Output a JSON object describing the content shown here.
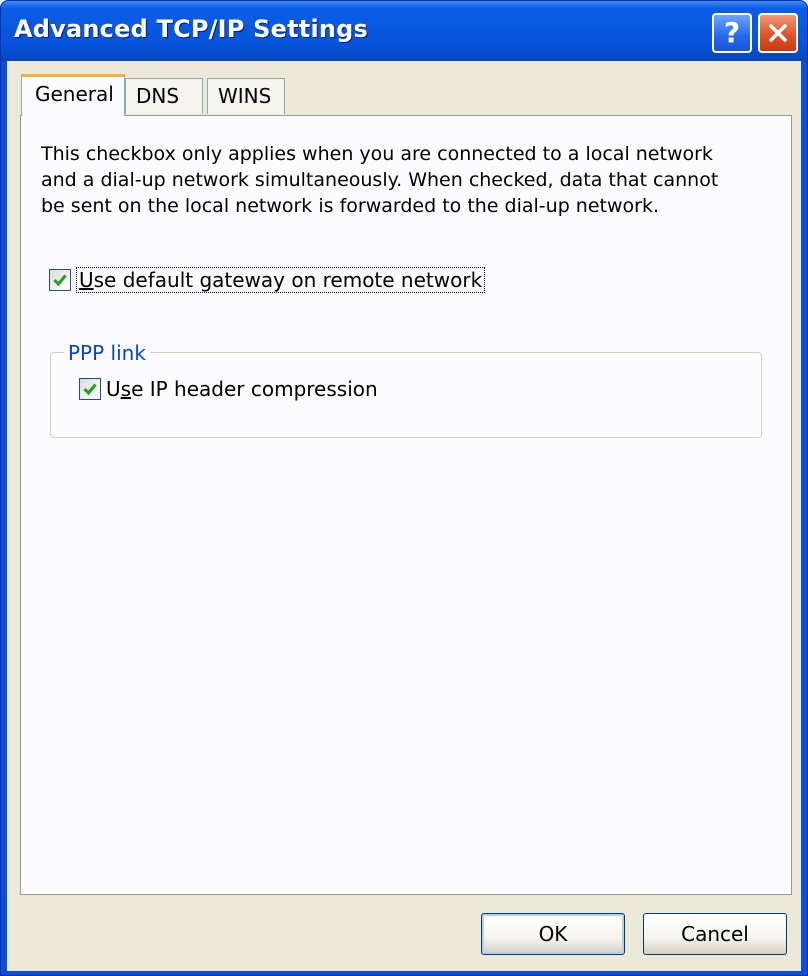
{
  "window": {
    "title": "Advanced TCP/IP Settings"
  },
  "titlebar_buttons": {
    "help_glyph": "?",
    "close_icon": "close-icon"
  },
  "tabs": [
    {
      "label": "General",
      "active": true
    },
    {
      "label": "DNS",
      "active": false
    },
    {
      "label": "WINS",
      "active": false
    }
  ],
  "general": {
    "description": "This checkbox only applies when you are connected to a local network and a dial-up network simultaneously.  When checked, data that cannot be sent on the local network is forwarded to the dial-up network.",
    "gateway_checkbox": {
      "label_prefix": "U",
      "label_rest": "se default gateway on remote network",
      "checked": true
    },
    "ppp_group": {
      "legend": "PPP link",
      "compression_checkbox": {
        "label_prefix": "U",
        "label_accel": "s",
        "label_rest": "e IP header compression",
        "checked": true
      }
    }
  },
  "buttons": {
    "ok_label": "OK",
    "cancel_label": "Cancel"
  },
  "colors": {
    "titlebar": "#0a58e0",
    "dialog_bg": "#ece9d8",
    "group_legend": "#0046d5",
    "check_mark": "#21a121",
    "close_button": "#e0532b"
  }
}
